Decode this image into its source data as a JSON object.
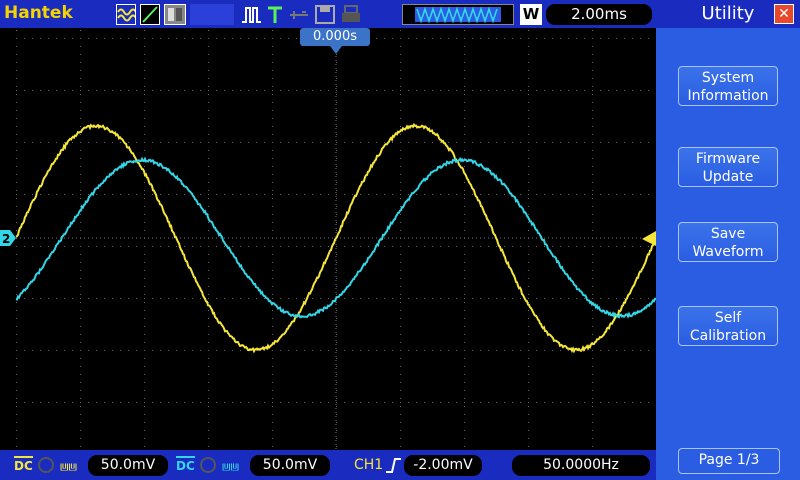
{
  "topbar": {
    "brand": "Hantek",
    "timebase": "2.00ms",
    "acq_mode_label": "W"
  },
  "screen": {
    "trigger_position": "0.000s",
    "ch2_marker": "2"
  },
  "bottombar": {
    "ch1_volts": "50.0mV",
    "ch2_volts": "50.0mV",
    "trigger_source": "CH1",
    "trigger_level": "-2.00mV",
    "frequency": "50.0000Hz",
    "coupling_ch1": "DC",
    "coupling_ch2": "DC"
  },
  "side": {
    "title": "Utility",
    "buttons": [
      {
        "label": "System\nInformation"
      },
      {
        "label": "Firmware\nUpdate"
      },
      {
        "label": "Save\nWaveform"
      },
      {
        "label": "Self\nCalibration"
      }
    ],
    "page": "Page 1/3"
  },
  "colors": {
    "ch1": "#f5e63a",
    "ch2": "#33d6e6",
    "bar": "#1a2cc0",
    "panel": "#2a5de2"
  }
}
